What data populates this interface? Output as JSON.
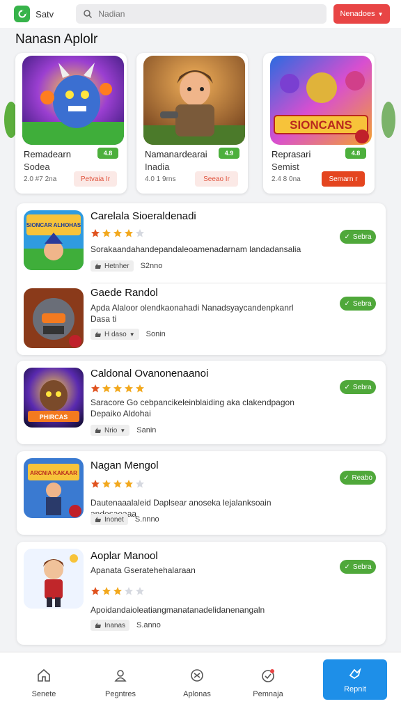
{
  "header": {
    "app_name": "Satv",
    "search_placeholder": "Nadian",
    "action_label": "Nenadoes"
  },
  "page_title": "Nanasn Aplolr",
  "featured": [
    {
      "name": "Remadearn",
      "sub": "Sodea",
      "meta": "2.0 #7 2na",
      "badge": "4.8",
      "button": "Petvaia Ir",
      "button_style": "light",
      "icon": "monster-art"
    },
    {
      "name": "Namanardearai",
      "sub": "Inadia",
      "meta": "4.0 1 9rns",
      "badge": "4.9",
      "button": "Seeao Ir",
      "button_style": "light",
      "icon": "warrior-art"
    },
    {
      "name": "Reprasari",
      "sub": "Semist",
      "meta": "2.4 8 0na",
      "badge": "4.8",
      "button": "Semarn r",
      "button_style": "solid",
      "icon": "sonicrans-art",
      "art_text": "SIONCANS"
    }
  ],
  "apps": [
    {
      "title": "Carelala Sioeraldenadi",
      "desc": "Sorakaandahandepandaleoamenadarnam landadansalia",
      "rating": 4,
      "chip": "Hetnher",
      "size": "S2nno",
      "button": "Sebra",
      "art_text": "SIONCAR ALHOHAS"
    },
    {
      "title": "Gaede Randol",
      "desc": "Apda Alaloor olendkaonahadi Nanadsyaycandenpkanrl Dasa ti",
      "rating": 0,
      "chip": "H daso",
      "size": "Sonin",
      "button": "Sebra"
    },
    {
      "title": "Caldonal Ovanonenaanoi",
      "desc": "Saracore Go cebpancikeleinblaiding aka clakendpagon Depaiko Aldohai",
      "rating": 5,
      "chip": "Nrio",
      "size": "Sanin",
      "button": "Sebra",
      "art_text": "PHIRCAS"
    },
    {
      "title": "Nagan Mengol",
      "desc": "Dautenaaalaleid Daplsear anoseka lejalanksoain andosaoaaa",
      "rating": 4,
      "chip": "Inonet",
      "size": "S.nnno",
      "button": "Reabo",
      "art_text": "ARCNIA KAKAAR"
    },
    {
      "title": "Aoplar Manool",
      "sub": "Apanata Gseratehehalaraan",
      "desc": "Apoidandaioleatiangmanatanadelidanenangaln",
      "rating": 3,
      "chip": "Inanas",
      "size": "S.anno",
      "button": "Sebra"
    }
  ],
  "nav": [
    {
      "label": "Senete",
      "icon": "home-icon"
    },
    {
      "label": "Pegntres",
      "icon": "games-icon"
    },
    {
      "label": "Aplonas",
      "icon": "apps-icon"
    },
    {
      "label": "Pemnaja",
      "icon": "updates-icon"
    },
    {
      "label": "Repnit",
      "icon": "hands-icon",
      "active": true
    }
  ],
  "colors": {
    "accent_green": "#4fa83a",
    "accent_red": "#e84545",
    "nav_active": "#1e8fe8"
  }
}
